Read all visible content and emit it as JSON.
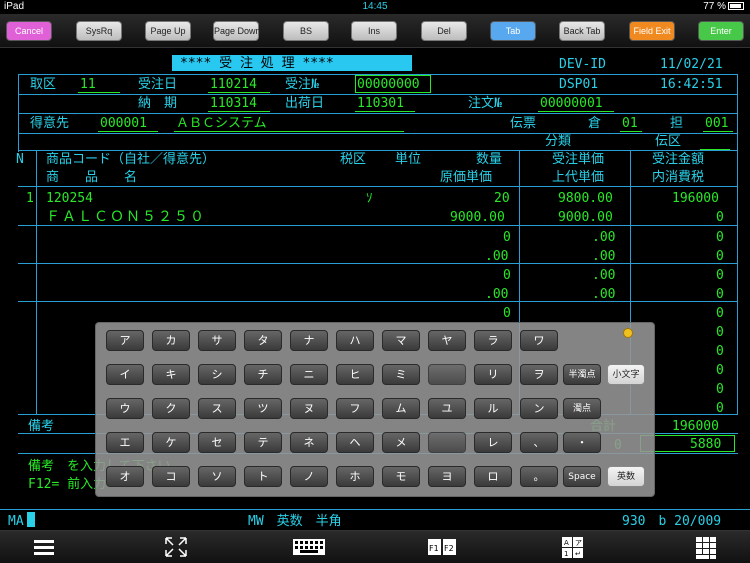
{
  "status": {
    "device": "iPad",
    "time": "14:45",
    "battery": "77 %"
  },
  "toolbar": {
    "buttons": [
      {
        "label": "Cancel",
        "color": "#e060d8"
      },
      {
        "label": "SysRq",
        "color": ""
      },
      {
        "label": "Page Up",
        "color": ""
      },
      {
        "label": "Page Down",
        "color": ""
      },
      {
        "label": "BS",
        "color": ""
      },
      {
        "label": "Ins",
        "color": ""
      },
      {
        "label": "Del",
        "color": ""
      },
      {
        "label": "Tab",
        "color": "#58a8f0"
      },
      {
        "label": "Back Tab",
        "color": ""
      },
      {
        "label": "Field Exit",
        "color": "#f08a20"
      },
      {
        "label": "Enter",
        "color": "#48c848"
      }
    ]
  },
  "screen": {
    "title": "**** 受 注 処 理 ****",
    "dev_id_label": "DEV-ID",
    "date": "11/02/21",
    "dsp": "DSP01",
    "clock": "16:42:51",
    "l1": {
      "torihiki_label": "取区",
      "torihiki": "11",
      "juchu_date_label": "受注日",
      "juchu_date": "110214",
      "juchu_no_label": "受注№",
      "juchu_no": "00000000"
    },
    "l2": {
      "noki_label": "納　期",
      "noki": "110314",
      "shuka_label": "出荷日",
      "shuka": "110301",
      "chumon_label": "注文№",
      "chumon": "00000001"
    },
    "l3": {
      "tokui_label": "得意先",
      "tokui_code": "000001",
      "tokui_name": "ＡＢＣシステム",
      "denpyo_label": "伝票",
      "so_label": "倉",
      "so": "01",
      "tan_label": "担",
      "tan": "001"
    },
    "l4": {
      "bunrui_label": "分類",
      "denku_label": "伝区"
    },
    "headers": {
      "n": "N",
      "shohin_code": "商品コード（自社／得意先）",
      "zeiku": "税区",
      "tani": "単位",
      "suryo": "数量",
      "juchu_tanka": "受注単価",
      "juchu_kingaku": "受注金額",
      "shohin_name": "商　　品　　名",
      "genka_tanka": "原価単価",
      "jodai_tanka": "上代単価",
      "uchi_shohizei": "内消費税"
    },
    "row1": {
      "n": "1",
      "code": "120254",
      "zeiku": "ｿ",
      "suryo": "20",
      "tanka": "9800.00",
      "kingaku": "196000",
      "name": "ＦＡＬＣＯＮ５２５０",
      "genka": "9000.00",
      "jodai": "9000.00",
      "zei": "0"
    },
    "empty_row": {
      "suryo": "0",
      "genka": ".00",
      "tanka": ".00",
      "kingaku": "0"
    },
    "biko_label": "備考",
    "gokei_label": "合計",
    "total": "196000",
    "zei_total": "5880",
    "zero": "0",
    "msg1": "備考　を入力して下さい",
    "msg2": "F12= 前入力",
    "ma": "MA",
    "mode": "MW　英数　半角",
    "position": "930　b 20/009"
  },
  "keyboard": {
    "rows": [
      [
        "ア",
        "カ",
        "サ",
        "タ",
        "ナ",
        "ハ",
        "マ",
        "ヤ",
        "ラ",
        "ワ"
      ],
      [
        "イ",
        "キ",
        "シ",
        "チ",
        "ニ",
        "ヒ",
        "ミ",
        "",
        "リ",
        "ヲ",
        "半濁点",
        "小文字"
      ],
      [
        "ウ",
        "ク",
        "ス",
        "ツ",
        "ヌ",
        "フ",
        "ム",
        "ユ",
        "ル",
        "ン",
        "濁点"
      ],
      [
        "エ",
        "ケ",
        "セ",
        "テ",
        "ネ",
        "ヘ",
        "メ",
        "",
        "レ",
        "、",
        "・"
      ],
      [
        "オ",
        "コ",
        "ソ",
        "ト",
        "ノ",
        "ホ",
        "モ",
        "ヨ",
        "ロ",
        "。",
        "Space",
        "英数"
      ]
    ]
  },
  "footer": {
    "icons": [
      "menu-icon",
      "fullscreen-icon",
      "keyboard-icon",
      "function-keys-icon",
      "input-mode-icon",
      "numpad-icon"
    ],
    "fkeys": "F1F2"
  }
}
